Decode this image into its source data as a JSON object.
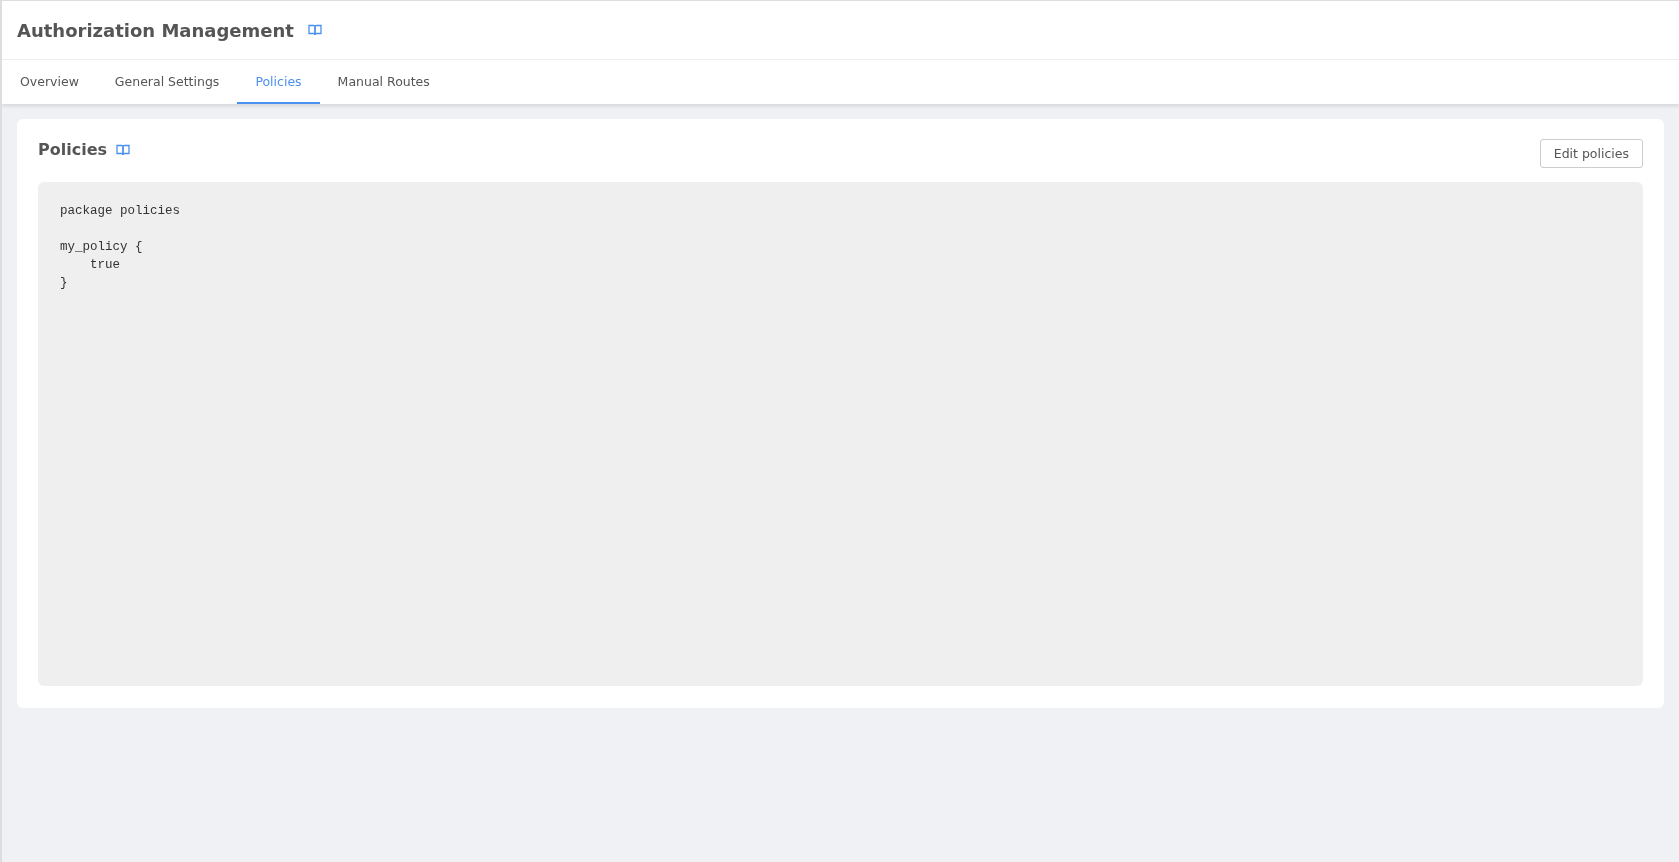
{
  "header": {
    "title": "Authorization Management"
  },
  "tabs": [
    {
      "label": "Overview",
      "selected": false
    },
    {
      "label": "General Settings",
      "selected": false
    },
    {
      "label": "Policies",
      "selected": true
    },
    {
      "label": "Manual Routes",
      "selected": false
    }
  ],
  "panel": {
    "title": "Policies",
    "button": "Edit policies",
    "code": "package policies\n\nmy_policy {\n    true\n}"
  }
}
